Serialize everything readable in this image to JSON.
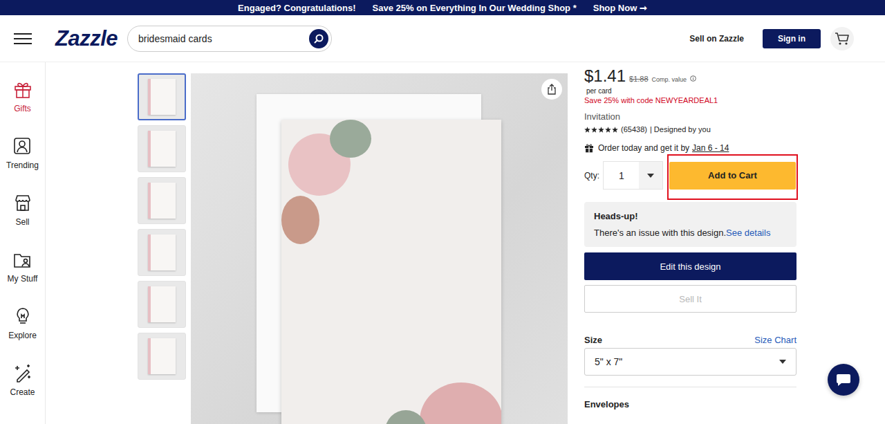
{
  "banner": {
    "items": [
      "Engaged? Congratulations!",
      "Save 25% on Everything In Our Wedding Shop *",
      "Shop Now ➞"
    ]
  },
  "header": {
    "logo": "Zazzle",
    "search": {
      "value": "bridesmaid cards"
    },
    "sell_link": "Sell on Zazzle",
    "sign_in": "Sign in"
  },
  "sidebar": {
    "items": [
      {
        "label": "Gifts",
        "icon": "gift",
        "selected": true
      },
      {
        "label": "Trending",
        "icon": "trending",
        "selected": false
      },
      {
        "label": "Sell",
        "icon": "sell",
        "selected": false
      },
      {
        "label": "My Stuff",
        "icon": "mystuff",
        "selected": false
      },
      {
        "label": "Explore",
        "icon": "explore",
        "selected": false
      },
      {
        "label": "Create",
        "icon": "create",
        "selected": false
      }
    ]
  },
  "thumbnails": [
    {
      "selected": true
    },
    {
      "selected": false
    },
    {
      "selected": false
    },
    {
      "selected": false
    },
    {
      "selected": false
    },
    {
      "selected": false
    }
  ],
  "product": {
    "price": "$1.41",
    "comp_price": "$1.88",
    "comp_label": "Comp. value",
    "unit": "per card",
    "promo": "Save 25% with code NEWYEARDEAL1",
    "type": "Invitation",
    "stars": 5,
    "review_count": "(65438)",
    "designer": "| Designed by you",
    "delivery_text": "Order today and get it by",
    "delivery_date": "Jan 6 - 14"
  },
  "purchase": {
    "qty_label": "Qty:",
    "qty": "1",
    "add_to_cart": "Add to Cart",
    "highlighted": true
  },
  "notice": {
    "title": "Heads-up!",
    "text": "There's an issue with this design.",
    "link": "See details"
  },
  "buttons": [
    {
      "label": "Edit this design",
      "disabled": false
    },
    {
      "label": "Sell It",
      "disabled": true
    }
  ],
  "size": {
    "label": "Size",
    "chart_link": "Size Chart",
    "value": "5\" x 7\""
  },
  "envelopes": {
    "label": "Envelopes"
  }
}
